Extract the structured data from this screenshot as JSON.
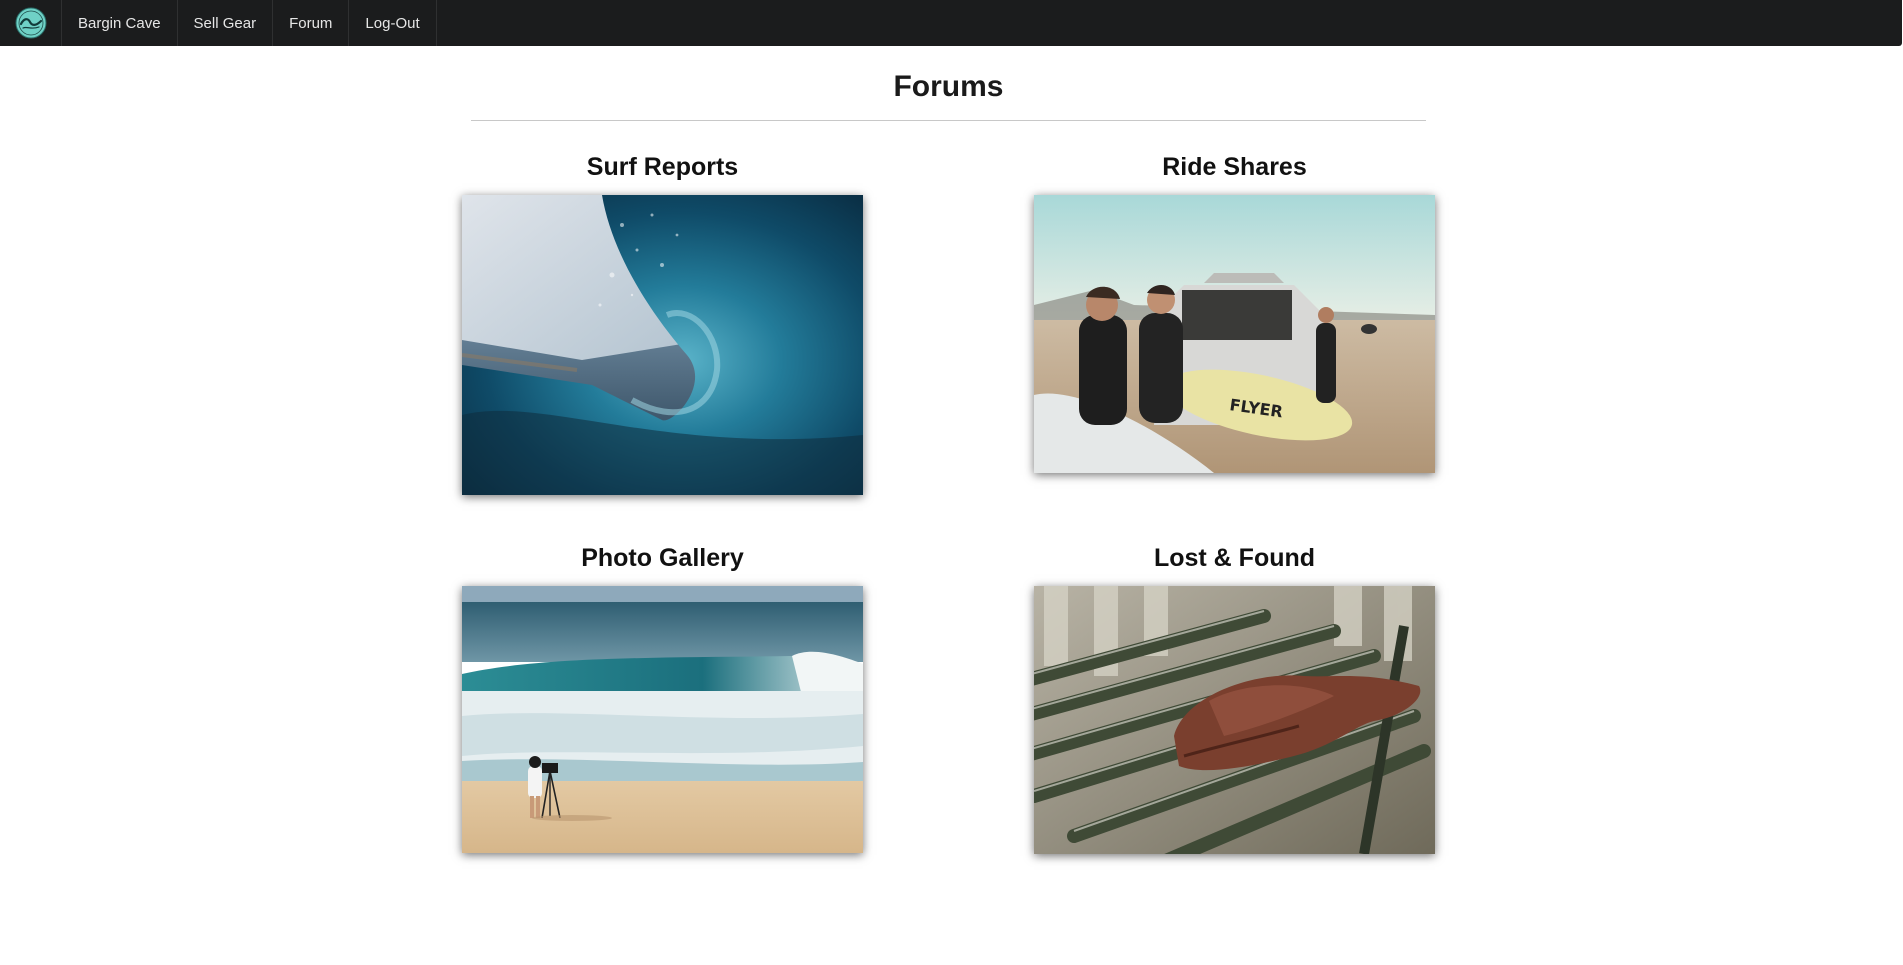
{
  "nav": {
    "logo_label": "",
    "items": [
      {
        "label": "Bargin Cave"
      },
      {
        "label": "Sell Gear"
      },
      {
        "label": "Forum"
      },
      {
        "label": "Log-Out"
      }
    ]
  },
  "page": {
    "title": "Forums"
  },
  "forums": [
    {
      "title": "Surf Reports",
      "image": "barreling-wave-photo"
    },
    {
      "title": "Ride Shares",
      "image": "surfers-loading-van-photo"
    },
    {
      "title": "Photo Gallery",
      "image": "photographer-on-beach-photo"
    },
    {
      "title": "Lost & Found",
      "image": "gloves-on-bench-photo"
    }
  ],
  "colors": {
    "navbar_bg": "#1b1c1d",
    "logo_teal": "#6fd1c6",
    "text_dark": "#111111"
  }
}
